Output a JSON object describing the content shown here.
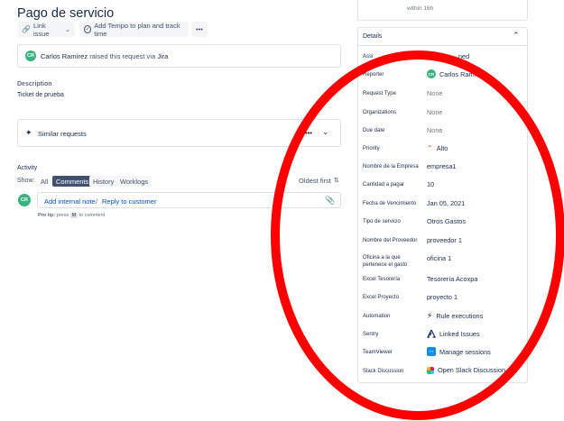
{
  "issue": {
    "title": "Pago de servicio"
  },
  "toolbar": {
    "link_issue": "Link issue",
    "tempo": "Add Tempo to plan and track time",
    "more": "•••"
  },
  "request": {
    "avatar_initials": "CR",
    "author": "Carlos Ramírez",
    "raised_text": "raised this request via",
    "channel": "Jira"
  },
  "description": {
    "label": "Description",
    "text": "Ticket de prueba"
  },
  "similar": {
    "label": "Similar requests",
    "more": "•••"
  },
  "activity": {
    "label": "Activity",
    "show_label": "Show:",
    "tabs": [
      "All",
      "Comments",
      "History",
      "Worklogs"
    ],
    "active_tab": "Comments",
    "sort": "Oldest first",
    "add_internal_note": "Add internal note",
    "separator": "/",
    "reply": "Reply to customer",
    "pro_tip_prefix": "Pro tip:",
    "pro_tip_press": "press",
    "pro_tip_key": "M",
    "pro_tip_suffix": "to comment"
  },
  "sla": {
    "text": "within 16h"
  },
  "details": {
    "header": "Details",
    "assignee_partial": "ned",
    "reporter": {
      "label": "Reporter",
      "initials": "CR",
      "value": "Carlos Ramírez"
    },
    "rows": [
      {
        "label": "Request Type",
        "value": "None"
      },
      {
        "label": "Organizations",
        "value": "None"
      },
      {
        "label": "Due date",
        "value": "None"
      },
      {
        "label": "Priority",
        "value": "Alto"
      },
      {
        "label": "Nombre de la Empresa",
        "value": "empresa1"
      },
      {
        "label": "Cantidad a pagar",
        "value": "10"
      },
      {
        "label": "Fecha de Vencimiento",
        "value": "Jan 05, 2021"
      },
      {
        "label": "Tipo de servicio",
        "value": "Otros Gastos"
      },
      {
        "label": "Nombre del Proveedor",
        "value": "proveedor 1"
      },
      {
        "label": "Oficina a la que pertenece el gasto",
        "value": "oficina 1"
      },
      {
        "label": "Excel Tesorería",
        "value": "Tesorería Acoxpa"
      },
      {
        "label": "Excel Proyecto",
        "value": "proyecto 1"
      },
      {
        "label": "Automation",
        "value": "Rule executions"
      },
      {
        "label": "Sentry",
        "value": "Linked Issues"
      },
      {
        "label": "TeamViewer",
        "value": "Manage sessions"
      },
      {
        "label": "Slack Discussion",
        "value": "Open Slack Discussion"
      }
    ]
  },
  "colors": {
    "annotation_ellipse": "#ff0000",
    "avatar": "#36b37e",
    "priority": "#ff5630"
  }
}
